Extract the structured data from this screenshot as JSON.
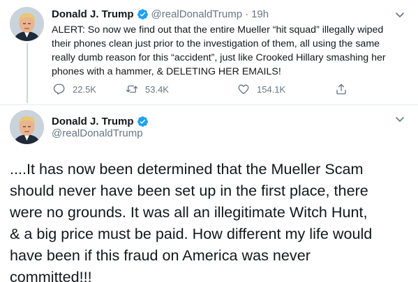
{
  "colors": {
    "text": "#14171a",
    "secondary": "#657786",
    "verified_blue": "#1da1f2",
    "thread_line": "#ccd6dd",
    "divider": "#e6ecf0"
  },
  "tweet1": {
    "author_name": "Donald J. Trump",
    "handle": "@realDonaldTrump",
    "separator": "·",
    "time": "19h",
    "verified_icon": "verified-badge-icon",
    "lines": [
      "ALERT: So now we find out that the entire Mueller “hit squad” illegally wiped",
      "their phones clean just prior to the investigation of them, all using the same",
      "really dumb reason for this “accident”, just like Crooked Hillary smashing her",
      "phones with a hammer, & DELETING HER EMAILS!"
    ],
    "actions": {
      "reply_count": "22.5K",
      "retweet_count": "53.4K",
      "like_count": "154.1K",
      "icons": [
        "reply-icon",
        "retweet-icon",
        "like-icon",
        "share-icon"
      ]
    }
  },
  "tweet2": {
    "author_name": "Donald J. Trump",
    "handle": "@realDonaldTrump",
    "verified_icon": "verified-badge-icon",
    "lines": [
      "....It has now been determined that the Mueller Scam",
      "should never have been set up in the first place, there",
      "were no grounds. It was all an illegitimate Witch Hunt,",
      "& a big price must be paid. How different my life would",
      "have been if this fraud on America was never",
      "committed!!!"
    ]
  }
}
